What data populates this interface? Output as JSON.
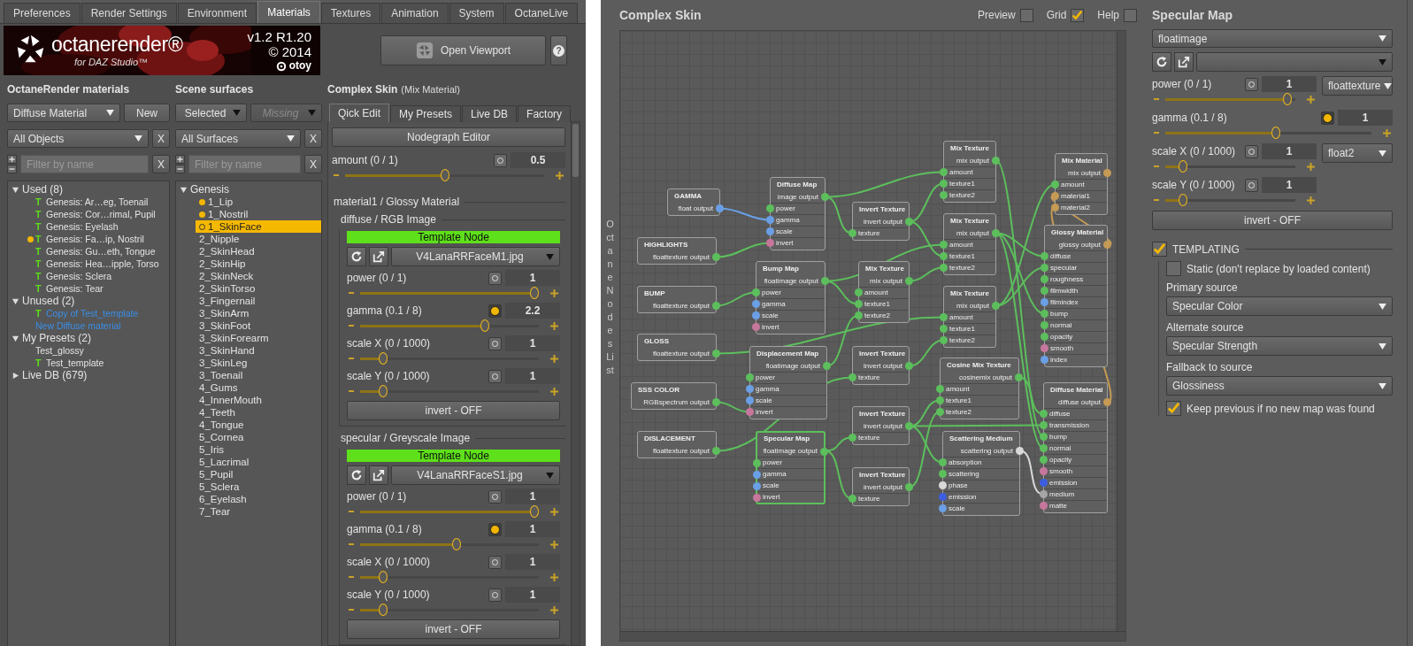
{
  "left_app": {
    "tabs": [
      {
        "label": "Preferences",
        "selected": false
      },
      {
        "label": "Render Settings",
        "selected": false
      },
      {
        "label": "Environment",
        "selected": false
      },
      {
        "label": "Materials",
        "selected": true
      },
      {
        "label": "Textures",
        "selected": false
      },
      {
        "label": "Animation",
        "selected": false
      },
      {
        "label": "System",
        "selected": false
      },
      {
        "label": "OctaneLive",
        "selected": false
      }
    ],
    "banner": {
      "logo": "octanerender®",
      "subtitle": "for DAZ Studio™",
      "version": "v1.2 R1.20",
      "copyright": "© 2014",
      "brand": "otoy"
    },
    "open_viewport": "Open Viewport",
    "help": "?",
    "materials": {
      "heading": "OctaneRender materials",
      "type_select": "Diffuse Material",
      "new_button": "New",
      "scope_select": "All Objects",
      "scope_clear": "X",
      "filter_placeholder": "Filter by name",
      "filter_clear": "X",
      "tree": [
        {
          "label": "Used (8)",
          "expanded": true,
          "children": [
            {
              "label": "Genesis: Ar…eg, Toenail",
              "badge": "T",
              "in_use": false,
              "highlighted": false
            },
            {
              "label": "Genesis: Cor…rimal, Pupil",
              "badge": "T",
              "in_use": false,
              "highlighted": false
            },
            {
              "label": "Genesis: Eyelash",
              "badge": "T",
              "in_use": false,
              "highlighted": false
            },
            {
              "label": "Genesis: Fa…ip, Nostril",
              "badge": "T",
              "in_use": true,
              "highlighted": false
            },
            {
              "label": "Genesis: Gu…eth, Tongue",
              "badge": "T",
              "in_use": false,
              "highlighted": false
            },
            {
              "label": "Genesis: Hea…ipple, Torso",
              "badge": "T",
              "in_use": false,
              "highlighted": false
            },
            {
              "label": "Genesis: Sclera",
              "badge": "T",
              "in_use": false,
              "highlighted": false
            },
            {
              "label": "Genesis: Tear",
              "badge": "T",
              "in_use": false,
              "highlighted": false
            }
          ]
        },
        {
          "label": "Unused (2)",
          "expanded": true,
          "children": [
            {
              "label": "Copy of Test_template",
              "badge": "T",
              "in_use": false,
              "highlighted": true
            },
            {
              "label": "New Diffuse material",
              "in_use": false,
              "highlighted": true
            }
          ]
        },
        {
          "label": "My Presets (2)",
          "expanded": true,
          "children": [
            {
              "label": "Test_glossy",
              "in_use": false,
              "highlighted": false
            },
            {
              "label": "Test_template",
              "badge": "T",
              "in_use": false,
              "highlighted": false
            }
          ]
        },
        {
          "label": "Live DB (679)",
          "expanded": false
        }
      ]
    },
    "surfaces": {
      "heading": "Scene surfaces",
      "mode_select": "Selected",
      "missing_select": "Missing",
      "missing_disabled": true,
      "scope_select": "All Surfaces",
      "scope_clear": "X",
      "filter_placeholder": "Filter by name",
      "filter_clear": "X",
      "tree": [
        {
          "label": "Genesis",
          "expanded": true,
          "children": [
            {
              "label": "1_Lip",
              "in_use": true,
              "selected": false
            },
            {
              "label": "1_Nostril",
              "in_use": true,
              "selected": false
            },
            {
              "label": "1_SkinFace",
              "in_use": true,
              "selected": true
            },
            {
              "label": "2_Nipple",
              "in_use": false,
              "selected": false
            },
            {
              "label": "2_SkinHead",
              "in_use": false,
              "selected": false
            },
            {
              "label": "2_SkinHip",
              "in_use": false,
              "selected": false
            },
            {
              "label": "2_SkinNeck",
              "in_use": false,
              "selected": false
            },
            {
              "label": "2_SkinTorso",
              "in_use": false,
              "selected": false
            },
            {
              "label": "3_Fingernail",
              "in_use": false,
              "selected": false
            },
            {
              "label": "3_SkinArm",
              "in_use": false,
              "selected": false
            },
            {
              "label": "3_SkinFoot",
              "in_use": false,
              "selected": false
            },
            {
              "label": "3_SkinForearm",
              "in_use": false,
              "selected": false
            },
            {
              "label": "3_SkinHand",
              "in_use": false,
              "selected": false
            },
            {
              "label": "3_SkinLeg",
              "in_use": false,
              "selected": false
            },
            {
              "label": "3_Toenail",
              "in_use": false,
              "selected": false
            },
            {
              "label": "4_Gums",
              "in_use": false,
              "selected": false
            },
            {
              "label": "4_InnerMouth",
              "in_use": false,
              "selected": false
            },
            {
              "label": "4_Teeth",
              "in_use": false,
              "selected": false
            },
            {
              "label": "4_Tongue",
              "in_use": false,
              "selected": false
            },
            {
              "label": "5_Cornea",
              "in_use": false,
              "selected": false
            },
            {
              "label": "5_Iris",
              "in_use": false,
              "selected": false
            },
            {
              "label": "5_Lacrimal",
              "in_use": false,
              "selected": false
            },
            {
              "label": "5_Pupil",
              "in_use": false,
              "selected": false
            },
            {
              "label": "5_Sclera",
              "in_use": false,
              "selected": false
            },
            {
              "label": "6_Eyelash",
              "in_use": false,
              "selected": false
            },
            {
              "label": "7_Tear",
              "in_use": false,
              "selected": false
            }
          ]
        }
      ]
    },
    "editor": {
      "title": "Complex Skin",
      "subtitle": "(Mix Material)",
      "tabs": [
        {
          "label": "Qick Edit",
          "selected": true
        },
        {
          "label": "My Presets",
          "selected": false
        },
        {
          "label": "Live DB",
          "selected": false
        },
        {
          "label": "Factory",
          "selected": false
        }
      ],
      "nodegraph_button": "Nodegraph Editor",
      "amount": {
        "label": "amount (0 / 1)",
        "value": "0.5",
        "level": 0.5,
        "toggle_on": false
      },
      "group_title": "material1 / Glossy Material",
      "sections": [
        {
          "title": "diffuse / RGB Image",
          "template_label": "Template Node",
          "file": "V4LanaRRFaceM1.jpg",
          "invert_button": "invert - OFF",
          "sliders": [
            {
              "label": "power (0 / 1)",
              "value": "1",
              "level": 1,
              "toggle_on": false
            },
            {
              "label": "gamma (0.1 / 8)",
              "value": "2.2",
              "level": 0.71,
              "toggle_on": true
            },
            {
              "label": "scale X (0 / 1000)",
              "value": "1",
              "level": 0.11,
              "toggle_on": false
            },
            {
              "label": "scale Y (0 / 1000)",
              "value": "1",
              "level": 0.11,
              "toggle_on": false
            }
          ]
        },
        {
          "title": "specular / Greyscale Image",
          "template_label": "Template Node",
          "file": "V4LanaRRFaceS1.jpg",
          "invert_button": "invert - OFF",
          "sliders": [
            {
              "label": "power (0 / 1)",
              "value": "1",
              "level": 1,
              "toggle_on": false
            },
            {
              "label": "gamma (0.1 / 8)",
              "value": "1",
              "level": 0.54,
              "toggle_on": true
            },
            {
              "label": "scale X (0 / 1000)",
              "value": "1",
              "level": 0.11,
              "toggle_on": false
            },
            {
              "label": "scale Y (0 / 1000)",
              "value": "1",
              "level": 0.11,
              "toggle_on": false
            }
          ]
        }
      ]
    }
  },
  "nodegraph": {
    "title": "Complex Skin",
    "options": [
      {
        "label": "Preview",
        "checked": false
      },
      {
        "label": "Grid",
        "checked": true
      },
      {
        "label": "Help",
        "checked": false
      }
    ],
    "side_label": "Octane Nodes List",
    "nodes": [
      {
        "title": "GAMMA",
        "output": {
          "label": "float output",
          "color": "#6a9fe6"
        },
        "selected": false
      },
      {
        "title": "HIGHLIGHTS",
        "output": {
          "label": "floattexture output",
          "color": "#5cbf5c"
        },
        "selected": false
      },
      {
        "title": "BUMP",
        "output": {
          "label": "floattexture output",
          "color": "#5cbf5c"
        },
        "selected": false
      },
      {
        "title": "GLOSS",
        "output": {
          "label": "floattexture output",
          "color": "#5cbf5c"
        },
        "selected": false
      },
      {
        "title": "SSS COLOR",
        "output": {
          "label": "RGBspectrum output",
          "color": "#5cbf5c"
        },
        "selected": false
      },
      {
        "title": "DISLACEMENT",
        "output": {
          "label": "floattexture output",
          "color": "#5cbf5c"
        },
        "selected": false
      },
      {
        "title": "Diffuse Map",
        "output": {
          "label": "image output",
          "color": "#5cbf5c"
        },
        "selected": false,
        "inputs": [
          {
            "name": "power",
            "color": "#5cbf5c"
          },
          {
            "name": "gamma",
            "color": "#6a9fe6"
          },
          {
            "name": "scale",
            "color": "#6a9fe6"
          },
          {
            "name": "invert",
            "color": "#c7779c"
          }
        ]
      },
      {
        "title": "Bump Map",
        "output": {
          "label": "floatimage output",
          "color": "#5cbf5c"
        },
        "selected": false,
        "inputs": [
          {
            "name": "power",
            "color": "#5cbf5c"
          },
          {
            "name": "gamma",
            "color": "#6a9fe6"
          },
          {
            "name": "scale",
            "color": "#6a9fe6"
          },
          {
            "name": "invert",
            "color": "#c7779c"
          }
        ]
      },
      {
        "title": "Displacement Map",
        "output": {
          "label": "floatimage output",
          "color": "#5cbf5c"
        },
        "selected": false,
        "inputs": [
          {
            "name": "power",
            "color": "#5cbf5c"
          },
          {
            "name": "gamma",
            "color": "#6a9fe6"
          },
          {
            "name": "scale",
            "color": "#6a9fe6"
          },
          {
            "name": "invert",
            "color": "#c7779c"
          }
        ]
      },
      {
        "title": "Specular Map",
        "output": {
          "label": "floatimage output",
          "color": "#5cbf5c"
        },
        "selected": true,
        "inputs": [
          {
            "name": "power",
            "color": "#5cbf5c"
          },
          {
            "name": "gamma",
            "color": "#6a9fe6"
          },
          {
            "name": "scale",
            "color": "#6a9fe6"
          },
          {
            "name": "invert",
            "color": "#c7779c"
          }
        ]
      },
      {
        "title": "Invert Texture",
        "output": {
          "label": "invert output",
          "color": "#5cbf5c"
        },
        "selected": false,
        "inputs": [
          {
            "name": "texture",
            "color": "#5cbf5c"
          }
        ]
      },
      {
        "title": "Mix Texture",
        "output": {
          "label": "mix output",
          "color": "#5cbf5c"
        },
        "selected": false,
        "inputs": [
          {
            "name": "amount",
            "color": "#5cbf5c"
          },
          {
            "name": "texture1",
            "color": "#5cbf5c"
          },
          {
            "name": "texture2",
            "color": "#5cbf5c"
          }
        ]
      },
      {
        "title": "Invert Texture",
        "output": {
          "label": "invert output",
          "color": "#5cbf5c"
        },
        "selected": false,
        "inputs": [
          {
            "name": "texture",
            "color": "#5cbf5c"
          }
        ]
      },
      {
        "title": "Invert Texture",
        "output": {
          "label": "invert output",
          "color": "#5cbf5c"
        },
        "selected": false,
        "inputs": [
          {
            "name": "texture",
            "color": "#5cbf5c"
          }
        ]
      },
      {
        "title": "Invert Texture",
        "output": {
          "label": "invert output",
          "color": "#5cbf5c"
        },
        "selected": false,
        "inputs": [
          {
            "name": "texture",
            "color": "#5cbf5c"
          }
        ]
      },
      {
        "title": "Mix Texture",
        "output": {
          "label": "mix output",
          "color": "#5cbf5c"
        },
        "selected": false,
        "inputs": [
          {
            "name": "amount",
            "color": "#5cbf5c"
          },
          {
            "name": "texture1",
            "color": "#5cbf5c"
          },
          {
            "name": "texture2",
            "color": "#5cbf5c"
          }
        ]
      },
      {
        "title": "Mix Texture",
        "output": {
          "label": "mix output",
          "color": "#5cbf5c"
        },
        "selected": false,
        "inputs": [
          {
            "name": "amount",
            "color": "#5cbf5c"
          },
          {
            "name": "texture1",
            "color": "#5cbf5c"
          },
          {
            "name": "texture2",
            "color": "#5cbf5c"
          }
        ]
      },
      {
        "title": "Mix Texture",
        "output": {
          "label": "mix output",
          "color": "#5cbf5c"
        },
        "selected": false,
        "inputs": [
          {
            "name": "amount",
            "color": "#5cbf5c"
          },
          {
            "name": "texture1",
            "color": "#5cbf5c"
          },
          {
            "name": "texture2",
            "color": "#5cbf5c"
          }
        ]
      },
      {
        "title": "Cosine Mix Texture",
        "output": {
          "label": "cosinemix output",
          "color": "#5cbf5c"
        },
        "selected": false,
        "inputs": [
          {
            "name": "amount",
            "color": "#5cbf5c"
          },
          {
            "name": "texture1",
            "color": "#5cbf5c"
          },
          {
            "name": "texture2",
            "color": "#5cbf5c"
          }
        ]
      },
      {
        "title": "Scattering Medium",
        "output": {
          "label": "scattering output",
          "color": "#d9d9d9"
        },
        "selected": false,
        "inputs": [
          {
            "name": "absorption",
            "color": "#5cbf5c"
          },
          {
            "name": "scattering",
            "color": "#5cbf5c"
          },
          {
            "name": "phase",
            "color": "#d9d9d9"
          },
          {
            "name": "emission",
            "color": "#3d5ee0"
          },
          {
            "name": "scale",
            "color": "#6a9fe6"
          }
        ]
      },
      {
        "title": "Mix Material",
        "output": {
          "label": "mix output",
          "color": "#c49a55"
        },
        "selected": false,
        "inputs": [
          {
            "name": "amount",
            "color": "#5cbf5c"
          },
          {
            "name": "material1",
            "color": "#c49a55"
          },
          {
            "name": "material2",
            "color": "#c49a55"
          }
        ]
      },
      {
        "title": "Glossy Material",
        "output": {
          "label": "glossy output",
          "color": "#c49a55"
        },
        "selected": false,
        "inputs": [
          {
            "name": "diffuse",
            "color": "#5cbf5c"
          },
          {
            "name": "specular",
            "color": "#5cbf5c"
          },
          {
            "name": "roughness",
            "color": "#5cbf5c"
          },
          {
            "name": "filmwidth",
            "color": "#5cbf5c"
          },
          {
            "name": "filmindex",
            "color": "#6a9fe6"
          },
          {
            "name": "bump",
            "color": "#5cbf5c"
          },
          {
            "name": "normal",
            "color": "#5cbf5c"
          },
          {
            "name": "opacity",
            "color": "#5cbf5c"
          },
          {
            "name": "smooth",
            "color": "#c7779c"
          },
          {
            "name": "index",
            "color": "#6a9fe6"
          }
        ]
      },
      {
        "title": "Diffuse Material",
        "output": {
          "label": "diffuse output",
          "color": "#c49a55"
        },
        "selected": false,
        "inputs": [
          {
            "name": "diffuse",
            "color": "#5cbf5c"
          },
          {
            "name": "transmission",
            "color": "#5cbf5c"
          },
          {
            "name": "bump",
            "color": "#5cbf5c"
          },
          {
            "name": "normal",
            "color": "#5cbf5c"
          },
          {
            "name": "opacity",
            "color": "#5cbf5c"
          },
          {
            "name": "smooth",
            "color": "#c7779c"
          },
          {
            "name": "emission",
            "color": "#3d5ee0"
          },
          {
            "name": "medium",
            "color": "#a6a6a6"
          },
          {
            "name": "matte",
            "color": "#c7779c"
          }
        ]
      }
    ]
  },
  "inspector": {
    "title": "Specular Map",
    "type_select": "floatimage",
    "sliders": [
      {
        "label": "power (0 / 1)",
        "value": "1",
        "level": 0.97,
        "toggle_on": false,
        "kind": "compact",
        "type": "floattexture"
      },
      {
        "label": "gamma (0.1 / 8)",
        "value": "1",
        "level": 0.54,
        "toggle_on": true,
        "kind": "full"
      },
      {
        "label": "scale X (0 / 1000)",
        "value": "1",
        "level": 0.11,
        "toggle_on": false,
        "kind": "compact",
        "type": "float2"
      },
      {
        "label": "scale Y (0 / 1000)",
        "value": "1",
        "level": 0.11,
        "toggle_on": false,
        "kind": "compact"
      }
    ],
    "invert_button": "invert - OFF",
    "templating": {
      "label": "TEMPLATING",
      "checked": true,
      "static": {
        "label": "Static (don't replace by loaded content)",
        "checked": false
      },
      "sources": [
        {
          "label": "Primary source",
          "value": "Specular Color"
        },
        {
          "label": "Alternate source",
          "value": "Specular Strength"
        },
        {
          "label": "Fallback to source",
          "value": "Glossiness"
        }
      ],
      "keep": {
        "label": "Keep previous if no new map was found",
        "checked": true
      }
    }
  }
}
